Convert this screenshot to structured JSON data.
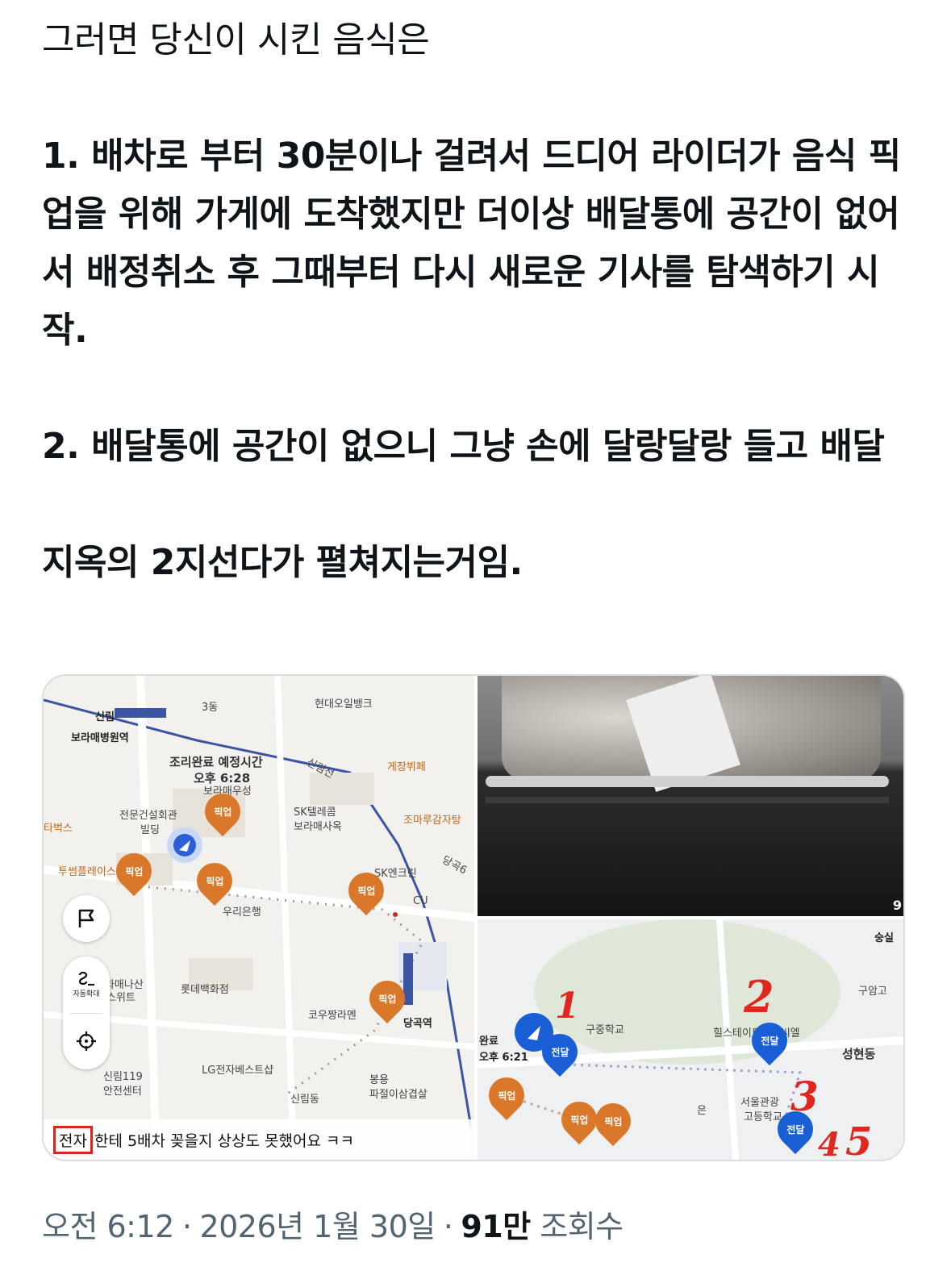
{
  "post": {
    "intro": "그러면 당신이 시킨 음식은",
    "point1": "1. 배차로 부터 30분이나 걸려서 드디어 라이더가 음식 픽업을 위해 가게에 도착했지만 더이상 배달통에 공간이 없어서 배정취소 후 그때부터 다시 새로운 기사를 탐색하기 시작.",
    "point2": "2. 배달통에 공간이 없으니 그냥 손에 달랑달랑 들고 배달",
    "closing": "지옥의 2지선다가 펼쳐지는거임."
  },
  "media": {
    "map_left": {
      "labels": {
        "station_sillim": "신림",
        "station_borame": "보라매병원역",
        "area_3dong": "3동",
        "hyundai_bank": "현대오일뱅크",
        "cook_done": "조리완료 예정시간",
        "cook_time": "오후 6:28",
        "borame_woosung": "보라매우성",
        "sillim_line": "신림선",
        "gyejang": "게장뷔페",
        "jeonmun": "전문건설회관",
        "building": "빌딩",
        "sk_telecom": "SK텔레콤",
        "sk_telecom_2": "보라매사옥",
        "jomaru": "조마루감자탕",
        "tabucks": "타벅스",
        "tusome": "투썸플레이스",
        "sk_enclean": "SK엔크린",
        "dangok_6": "당곡6",
        "cu": "CU",
        "woori_bank": "우리은행",
        "borame_nasan": "보라매나산",
        "suite": "스위트",
        "lotte": "롯데백화점",
        "kowoo": "코우짱라멘",
        "dangok_station": "당곡역",
        "sillim_119": "신림119",
        "safety_center": "안전센터",
        "lg_best": "LG전자베스트샵",
        "sillim_dong": "신림동",
        "bongyong": "봉용",
        "pajeol": "파절이삼겹살",
        "pickup": "픽업",
        "auto_zoom": "자동확대"
      },
      "caption_highlight": "전자",
      "caption_rest": "한테 5배차 꽂을지 상상도 못했어요 ㅋㅋ"
    },
    "photo": {
      "index": "9"
    },
    "map_right": {
      "labels": {
        "sungsil": "숭실",
        "gurim": "구암고",
        "hilstate": "힐스테이트센트씨엘",
        "seonghyeon": "성현동",
        "school_1": "구중학교",
        "school_2": "서울관광",
        "school_3": "고등학교",
        "eun": "은",
        "time_partial_1": "완료",
        "time_partial_2": "오후 6:21",
        "deliver": "전달",
        "pickup": "픽업"
      },
      "annotations": [
        "1",
        "2",
        "3",
        "4",
        "5"
      ]
    }
  },
  "meta": {
    "time": "오전 6:12",
    "date": "2026년 1월 30일",
    "views_count": "91만",
    "views_label": "조회수",
    "separator": "·"
  },
  "colors": {
    "text": "#0f1419",
    "meta_text": "#536471",
    "pickup_pin": "#d9772a",
    "deliver_pin": "#1a5ed6",
    "annotation_red": "#e0261d",
    "rail_blue": "#3b55a3"
  }
}
